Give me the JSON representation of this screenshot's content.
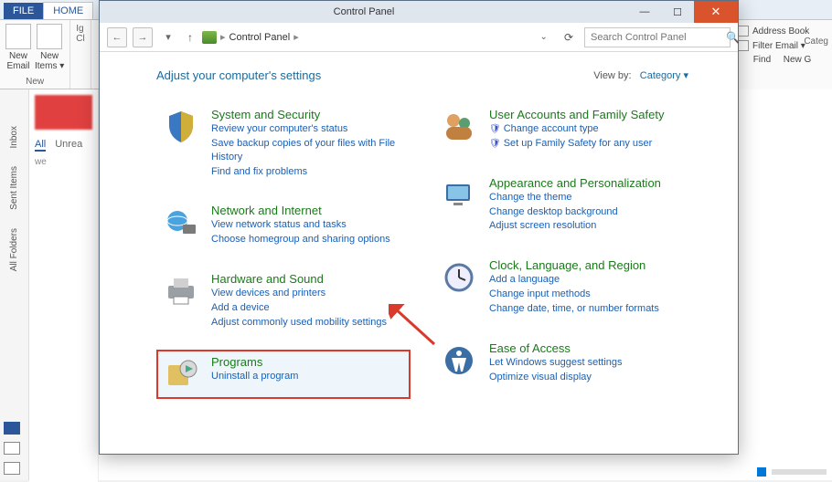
{
  "bg": {
    "tabs": {
      "file": "FILE",
      "home": "HOME"
    },
    "group_new": {
      "new_email": "New\nEmail",
      "new_items": "New\nItems ▾",
      "label": "New"
    },
    "group_del": {
      "ign": "Ig",
      "cl": "Cl"
    },
    "right_pane": {
      "address_book": "Address Book",
      "filter": "Filter Email ▾",
      "find": "Find",
      "new_g": "New G",
      "categ": "Categ"
    },
    "left_rail": [
      "Inbox",
      "Sent Items",
      "All Folders"
    ],
    "inbox": {
      "all": "All",
      "unread": "Unrea",
      "we": "we"
    }
  },
  "window": {
    "title": "Control Panel",
    "breadcrumb": [
      "Control Panel"
    ],
    "search_placeholder": "Search Control Panel",
    "heading": "Adjust your computer's settings",
    "viewby_label": "View by:",
    "viewby_value": "Category ▾"
  },
  "cats": {
    "sys": {
      "title": "System and Security",
      "links": [
        "Review your computer's status",
        "Save backup copies of your files with File History",
        "Find and fix problems"
      ]
    },
    "net": {
      "title": "Network and Internet",
      "links": [
        "View network status and tasks",
        "Choose homegroup and sharing options"
      ]
    },
    "hw": {
      "title": "Hardware and Sound",
      "links": [
        "View devices and printers",
        "Add a device",
        "Adjust commonly used mobility settings"
      ]
    },
    "prog": {
      "title": "Programs",
      "links": [
        "Uninstall a program"
      ]
    },
    "user": {
      "title": "User Accounts and Family Safety",
      "links": [
        "Change account type",
        "Set up Family Safety for any user"
      ]
    },
    "appear": {
      "title": "Appearance and Personalization",
      "links": [
        "Change the theme",
        "Change desktop background",
        "Adjust screen resolution"
      ]
    },
    "clock": {
      "title": "Clock, Language, and Region",
      "links": [
        "Add a language",
        "Change input methods",
        "Change date, time, or number formats"
      ]
    },
    "ease": {
      "title": "Ease of Access",
      "links": [
        "Let Windows suggest settings",
        "Optimize visual display"
      ]
    }
  }
}
